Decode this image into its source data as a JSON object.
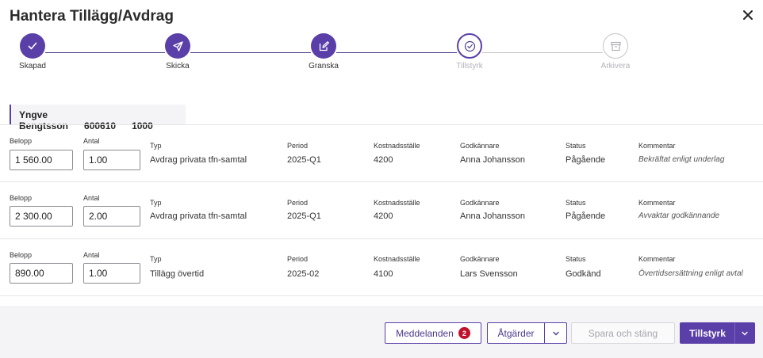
{
  "title": "Hantera Tillägg/Avdrag",
  "steps": [
    {
      "label": "Skapad",
      "state": "done",
      "icon": "check-icon"
    },
    {
      "label": "Skicka",
      "state": "done",
      "icon": "send-icon"
    },
    {
      "label": "Granska",
      "state": "done",
      "icon": "edit-icon"
    },
    {
      "label": "Tillstyrk",
      "state": "active",
      "icon": "check-circle-icon"
    },
    {
      "label": "Arkivera",
      "state": "todo",
      "icon": "archive-icon"
    }
  ],
  "employee": {
    "name": "Yngve Bengtsson",
    "id": "600610",
    "code": "1000"
  },
  "labels": {
    "belopp": "Belopp",
    "antal": "Antal",
    "typ": "Typ",
    "period": "Period",
    "kostnadsstalle": "Kostnadsställe",
    "godkannare": "Godkännare",
    "status": "Status",
    "kommentar": "Kommentar"
  },
  "rows": [
    {
      "belopp": "1 560.00",
      "antal": "1.00",
      "typ": "Avdrag privata tfn-samtal",
      "period": "2025-Q1",
      "kostnadsstalle": "4200",
      "godkannare": "Anna Johansson",
      "status": "Pågående",
      "kommentar": "Bekräftat enligt underlag"
    },
    {
      "belopp": "2 300.00",
      "antal": "2.00",
      "typ": "Avdrag privata tfn-samtal",
      "period": "2025-Q1",
      "kostnadsstalle": "4200",
      "godkannare": "Anna Johansson",
      "status": "Pågående",
      "kommentar": "Avvaktar godkännande"
    },
    {
      "belopp": "890.00",
      "antal": "1.00",
      "typ": "Tillägg övertid",
      "period": "2025-02",
      "kostnadsstalle": "4100",
      "godkannare": "Lars Svensson",
      "status": "Godkänd",
      "kommentar": "Övertidsersättning enligt avtal"
    }
  ],
  "footer": {
    "meddelanden": "Meddelanden",
    "meddelanden_count": "2",
    "atgarder": "Åtgärder",
    "spara": "Spara och stäng",
    "tillstyrk": "Tillstyrk"
  },
  "colors": {
    "accent": "#5a3fa8",
    "badge": "#c2112a"
  }
}
